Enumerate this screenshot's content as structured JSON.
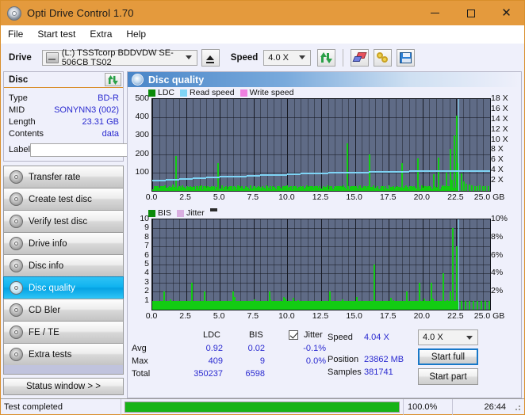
{
  "window": {
    "title": "Opti Drive Control 1.70",
    "icon": "disc-icon",
    "controls": {
      "minimize": "—",
      "maximize": "□",
      "close": "✕"
    }
  },
  "menu": {
    "items": [
      "File",
      "Start test",
      "Extra",
      "Help"
    ]
  },
  "toolbar": {
    "drive_label": "Drive",
    "drive_value": "(L:)  TSSTcorp BDDVDW SE-506CB TS02",
    "eject_icon": "eject-icon",
    "speed_label": "Speed",
    "speed_value": "4.0 X",
    "refresh_icon": "refresh-icon",
    "eraser_icon": "eraser-icon",
    "chain_icon": "chain-icon",
    "save_icon": "save-icon"
  },
  "disc": {
    "header": "Disc",
    "refresh_icon": "refresh-icon",
    "rows": [
      {
        "key": "Type",
        "value": "BD-R"
      },
      {
        "key": "MID",
        "value": "SONYNN3 (002)"
      },
      {
        "key": "Length",
        "value": "23.31 GB"
      },
      {
        "key": "Contents",
        "value": "data"
      }
    ],
    "label_key": "Label",
    "label_value": "",
    "label_placeholder": "",
    "cd_icon": "cd-icon"
  },
  "nav": {
    "items": [
      {
        "label": "Transfer rate",
        "icon": "disc-icon",
        "active": false
      },
      {
        "label": "Create test disc",
        "icon": "disc-icon",
        "active": false
      },
      {
        "label": "Verify test disc",
        "icon": "disc-icon",
        "active": false
      },
      {
        "label": "Drive info",
        "icon": "disc-icon",
        "active": false
      },
      {
        "label": "Disc info",
        "icon": "disc-icon",
        "active": false
      },
      {
        "label": "Disc quality",
        "icon": "disc-icon",
        "active": true
      },
      {
        "label": "CD Bler",
        "icon": "disc-icon",
        "active": false
      },
      {
        "label": "FE / TE",
        "icon": "disc-icon",
        "active": false
      },
      {
        "label": "Extra tests",
        "icon": "disc-icon",
        "active": false
      }
    ],
    "status_button": "Status window > >"
  },
  "panel": {
    "title": "Disc quality",
    "icon": "disc-icon"
  },
  "stats": {
    "col_headers": [
      "LDC",
      "BIS"
    ],
    "row_labels": [
      "Avg",
      "Max",
      "Total"
    ],
    "ldc": {
      "avg": "0.92",
      "max": "409",
      "total": "350237"
    },
    "bis": {
      "avg": "0.02",
      "max": "9",
      "total": "6598"
    },
    "jitter": {
      "label": "Jitter",
      "checked": true,
      "avg": "-0.1%",
      "max": "0.0%"
    },
    "speed_label": "Speed",
    "speed_value": "4.04 X",
    "position_label": "Position",
    "position_value": "23862 MB",
    "samples_label": "Samples",
    "samples_value": "381741",
    "speed_select": "4.0 X",
    "start_full": "Start full",
    "start_part": "Start part"
  },
  "statusbar": {
    "message": "Test completed",
    "percent_label": "100.0%",
    "percent_value": 100,
    "elapsed": "26:44"
  },
  "chart_data": [
    {
      "type": "bar",
      "name": "ldc-chart",
      "title": "",
      "xlabel": "GB",
      "ylabel": "",
      "xlim": [
        0,
        25
      ],
      "ylim": [
        0,
        500
      ],
      "xticks": [
        "0.0",
        "2.5",
        "5.0",
        "7.5",
        "10.0",
        "12.5",
        "15.0",
        "17.5",
        "20.0",
        "22.5",
        "25.0 GB"
      ],
      "yticks": [
        "100",
        "200",
        "300",
        "400",
        "500"
      ],
      "right_axis": {
        "label": "X",
        "ylim": [
          0,
          18
        ],
        "yticks": [
          "2 X",
          "4 X",
          "6 X",
          "8 X",
          "10 X",
          "12 X",
          "14 X",
          "16 X",
          "18 X"
        ]
      },
      "legend": [
        {
          "name": "LDC",
          "color": "#13cc13"
        },
        {
          "name": "Read speed",
          "color": "#7fd4f5"
        },
        {
          "name": "Write speed",
          "color": "#ef7fe0"
        }
      ],
      "grid": true,
      "series": [
        {
          "name": "LDC",
          "color": "#13cc13",
          "x": [
            0.1,
            0.35,
            0.6,
            0.9,
            1.2,
            1.45,
            1.7,
            1.72,
            1.95,
            2.2,
            2.5,
            2.8,
            3.05,
            3.3,
            3.6,
            3.9,
            4.2,
            4.5,
            4.8,
            5.1,
            5.4,
            5.7,
            6.0,
            6.3,
            6.6,
            6.9,
            7.2,
            7.5,
            7.8,
            8.1,
            8.4,
            8.7,
            9.0,
            9.3,
            9.6,
            9.9,
            10.2,
            10.5,
            10.8,
            11.1,
            11.4,
            11.7,
            12.0,
            12.3,
            12.6,
            12.9,
            13.2,
            13.5,
            13.8,
            14.1,
            14.4,
            14.7,
            15.0,
            15.3,
            15.6,
            15.9,
            16.0,
            16.3,
            16.6,
            16.9,
            17.2,
            17.5,
            17.8,
            18.1,
            18.4,
            18.7,
            19.0,
            19.3,
            19.6,
            19.9,
            20.2,
            20.5,
            20.8,
            21.1,
            21.4,
            21.7,
            22.0,
            22.1,
            22.3,
            22.45,
            22.5,
            22.6,
            22.8,
            23.0,
            23.2,
            23.4,
            23.6,
            23.8,
            24.0,
            24.2,
            24.4,
            24.6,
            24.8
          ],
          "values": [
            20,
            25,
            18,
            30,
            22,
            35,
            28,
            190,
            24,
            30,
            26,
            22,
            28,
            24,
            30,
            26,
            22,
            28,
            150,
            30,
            26,
            24,
            28,
            32,
            26,
            22,
            30,
            28,
            24,
            26,
            30,
            28,
            22,
            26,
            24,
            30,
            28,
            26,
            22,
            28,
            30,
            26,
            24,
            28,
            26,
            30,
            28,
            26,
            24,
            30,
            260,
            28,
            26,
            30,
            28,
            26,
            200,
            30,
            28,
            26,
            24,
            30,
            28,
            26,
            150,
            30,
            28,
            26,
            175,
            30,
            28,
            26,
            90,
            180,
            30,
            100,
            230,
            60,
            300,
            140,
            409,
            150,
            95,
            50,
            40,
            35,
            30,
            28,
            26,
            30,
            28,
            26,
            24
          ]
        },
        {
          "name": "Read speed",
          "color": "#7fd4f5",
          "x": [
            0,
            1,
            2,
            3,
            4,
            5,
            6,
            7,
            8,
            9,
            10,
            11,
            12,
            13,
            14,
            15,
            16,
            17,
            18,
            19,
            20,
            21,
            22,
            22.4,
            22.6,
            23,
            24,
            25
          ],
          "values": [
            2.2,
            2.35,
            2.5,
            2.65,
            2.8,
            2.9,
            3.0,
            3.1,
            3.2,
            3.3,
            3.4,
            3.5,
            3.6,
            3.65,
            3.7,
            3.8,
            3.85,
            3.9,
            3.95,
            4.0,
            4.0,
            4.05,
            4.05,
            4.05,
            4.05,
            4.05,
            4.05,
            4.05
          ],
          "unit": "X"
        }
      ]
    },
    {
      "type": "bar",
      "name": "bis-chart",
      "title": "",
      "xlabel": "GB",
      "ylabel": "",
      "xlim": [
        0,
        25
      ],
      "ylim": [
        0,
        10
      ],
      "xticks": [
        "0.0",
        "2.5",
        "5.0",
        "7.5",
        "10.0",
        "12.5",
        "15.0",
        "17.5",
        "20.0",
        "22.5",
        "25.0 GB"
      ],
      "yticks": [
        "1",
        "2",
        "3",
        "4",
        "5",
        "6",
        "7",
        "8",
        "9",
        "10"
      ],
      "right_axis": {
        "label": "%",
        "ylim": [
          0,
          10
        ],
        "yticks": [
          "2%",
          "4%",
          "6%",
          "8%",
          "10%"
        ]
      },
      "legend": [
        {
          "name": "BIS",
          "color": "#13cc13"
        },
        {
          "name": "Jitter",
          "color": "#d9aee0"
        }
      ],
      "grid": true,
      "series": [
        {
          "name": "BIS",
          "color": "#13cc13",
          "x": [
            0.2,
            0.5,
            0.8,
            1.1,
            1.4,
            1.7,
            2.0,
            2.3,
            2.6,
            2.9,
            3.2,
            3.5,
            3.8,
            4.1,
            4.4,
            4.7,
            5.0,
            5.3,
            5.6,
            5.9,
            6.2,
            6.5,
            6.8,
            7.1,
            7.4,
            7.7,
            8.0,
            8.3,
            8.6,
            8.9,
            9.2,
            9.5,
            9.8,
            10.1,
            10.4,
            10.7,
            11.0,
            11.3,
            11.6,
            11.9,
            12.2,
            12.5,
            12.8,
            13.1,
            13.4,
            13.7,
            14.0,
            14.3,
            14.6,
            14.9,
            15.2,
            15.5,
            15.8,
            16.1,
            16.4,
            16.7,
            17.0,
            17.3,
            17.6,
            17.9,
            18.2,
            18.5,
            18.8,
            19.1,
            19.4,
            19.7,
            20.0,
            20.3,
            20.6,
            20.9,
            21.2,
            21.5,
            21.8,
            22.0,
            22.2,
            22.35,
            22.5,
            22.6,
            22.8,
            23.1,
            23.4,
            23.7,
            24.0,
            24.3,
            24.6,
            24.9
          ],
          "values": [
            1,
            1,
            2,
            1,
            1,
            1,
            1,
            1,
            1,
            3,
            1,
            1,
            2,
            1,
            1,
            1,
            1,
            1,
            1,
            2,
            1,
            1,
            1,
            1,
            1,
            1,
            1,
            1,
            2,
            1,
            1,
            1,
            1,
            1,
            1,
            1,
            1,
            1,
            1,
            1,
            1,
            1,
            1,
            2,
            1,
            1,
            1,
            1,
            1,
            1,
            1,
            1,
            1,
            1,
            5,
            1,
            1,
            1,
            1,
            1,
            1,
            1,
            2,
            1,
            1,
            3,
            1,
            1,
            3,
            1,
            1,
            4,
            1,
            2,
            9,
            1,
            7,
            1,
            1,
            1,
            1,
            1,
            1,
            1,
            1,
            1
          ]
        }
      ],
      "baseline": 1
    }
  ]
}
